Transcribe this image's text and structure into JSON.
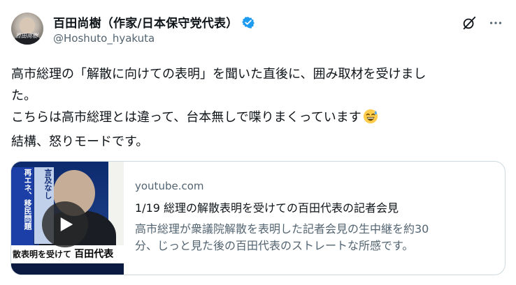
{
  "author": {
    "name": "百田尚樹（作家/日本保守党代表）",
    "handle": "@Hoshuto_hyakuta",
    "verified_color": "#1d9bf0",
    "avatar_signature": "百田尚樹"
  },
  "icons": {
    "grok": "grok-icon",
    "more": "more-icon",
    "verified": "verified-badge-icon",
    "emoji": "sweat-smile-emoji",
    "play": "play-icon"
  },
  "tweet": {
    "lines": [
      "高市総理の「解散に向けての表明」を聞いた直後に、囲み取材を受けまし",
      "た。",
      "こちらは高市総理とは違って、台本無しで喋りまくっています",
      "結構、怒りモードです。"
    ]
  },
  "card": {
    "domain": "youtube.com",
    "title": "1/19 総理の解散表明を受けての百田代表の記者会見",
    "description_lines": [
      "高市総理が衆議院解散を表明した記者会見の生中継を約30",
      "分、じっと見た後の百田代表のストレートな所感です。"
    ],
    "thumbnail": {
      "side_text_1": "再エネ、移民問題",
      "side_text_2": "言及なし",
      "strip_text": "散表明を受けて",
      "strip_name": "百田代表"
    }
  }
}
